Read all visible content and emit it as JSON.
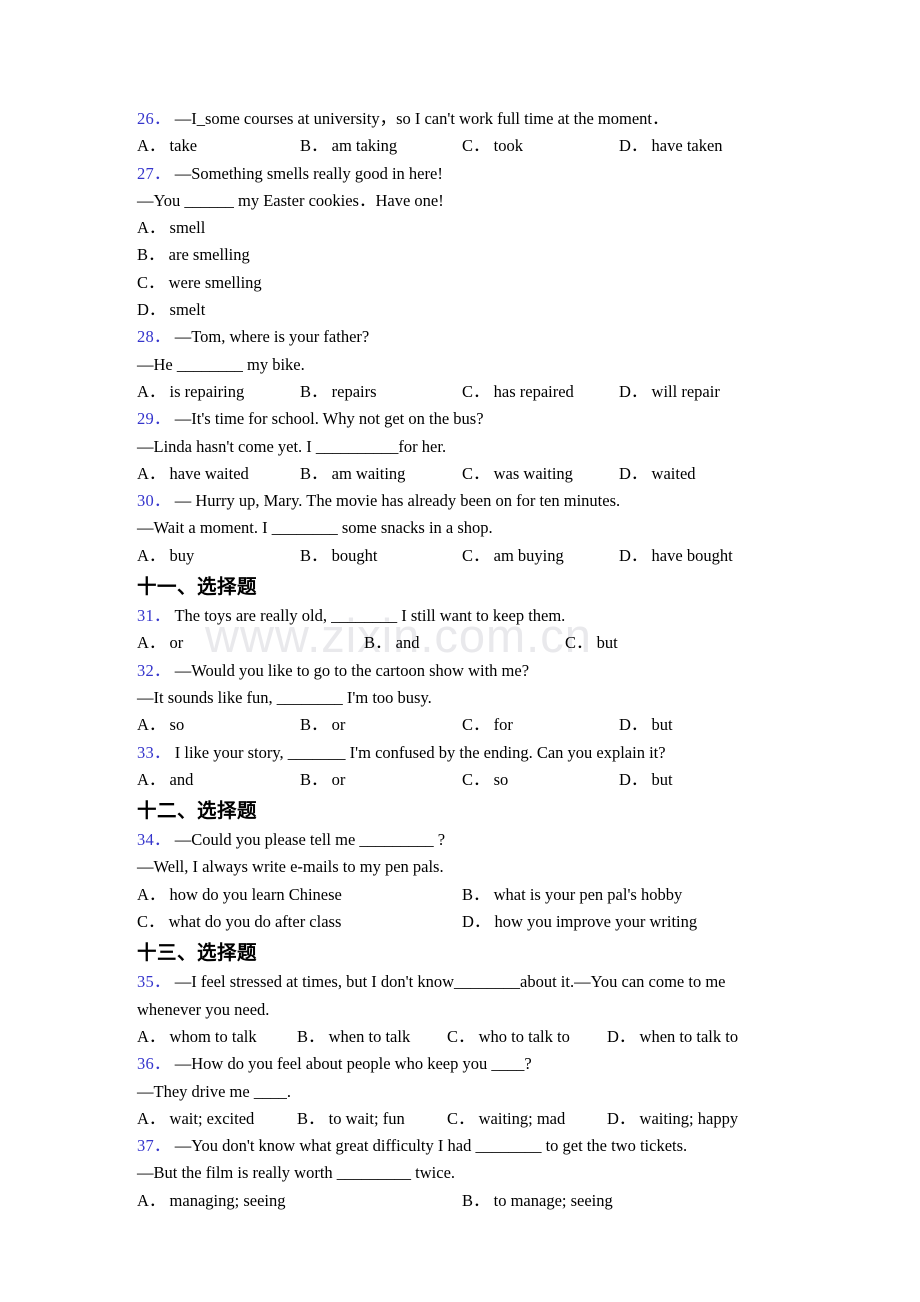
{
  "watermark": {
    "text": "www.zixin.com.cn",
    "color": "#e9e9ec"
  },
  "accent": {
    "question_number_color": "#3535cc"
  },
  "blocks": [
    {
      "kind": "question",
      "number": "26．",
      "stem": "—I_some courses at university，so I can't work full time at the moment．",
      "layout": "c4",
      "options": [
        {
          "letter": "A．",
          "text": "take"
        },
        {
          "letter": "B．",
          "text": "am taking"
        },
        {
          "letter": "C．",
          "text": "took"
        },
        {
          "letter": "D．",
          "text": "have taken"
        }
      ]
    },
    {
      "kind": "question",
      "number": "27．",
      "stem": "—Something smells really good in here!",
      "stem2": "—You ______ my Easter cookies．Have one!",
      "layout": "stacked",
      "options": [
        {
          "letter": "A．",
          "text": "smell"
        },
        {
          "letter": "B．",
          "text": "are smelling"
        },
        {
          "letter": "C．",
          "text": "were smelling"
        },
        {
          "letter": "D．",
          "text": "smelt"
        }
      ]
    },
    {
      "kind": "question",
      "number": "28．",
      "stem": "—Tom, where is your father?",
      "stem2": "—He ________ my bike.",
      "layout": "c4",
      "options": [
        {
          "letter": "A．",
          "text": "is repairing"
        },
        {
          "letter": "B．",
          "text": "repairs"
        },
        {
          "letter": "C．",
          "text": "has repaired"
        },
        {
          "letter": "D．",
          "text": "will repair"
        }
      ]
    },
    {
      "kind": "question",
      "number": "29．",
      "stem": "—It's time for school. Why not get on the bus?",
      "stem2": "—Linda hasn't come yet. I __________for her.",
      "layout": "c4",
      "options": [
        {
          "letter": "A．",
          "text": "have waited"
        },
        {
          "letter": "B．",
          "text": "am waiting"
        },
        {
          "letter": "C．",
          "text": "was waiting"
        },
        {
          "letter": "D．",
          "text": "waited"
        }
      ]
    },
    {
      "kind": "question",
      "number": "30．",
      "stem": "— Hurry up, Mary. The movie has already been on for ten minutes.",
      "stem2": "—Wait a moment. I ________ some snacks in a shop.",
      "layout": "c4",
      "options": [
        {
          "letter": "A．",
          "text": "buy"
        },
        {
          "letter": "B．",
          "text": "bought"
        },
        {
          "letter": "C．",
          "text": "am buying"
        },
        {
          "letter": "D．",
          "text": "have bought"
        }
      ]
    },
    {
      "kind": "heading",
      "text": "十一、选择题"
    },
    {
      "kind": "question",
      "number": "31．",
      "stem": "The toys are really old, ________ I still want to keep them.",
      "layout": "c3",
      "options": [
        {
          "letter": "A．",
          "text": "or"
        },
        {
          "letter": "B．",
          "text": "and"
        },
        {
          "letter": "C．",
          "text": "but"
        }
      ]
    },
    {
      "kind": "question",
      "number": "32．",
      "stem": "—Would you like to go to the cartoon show with me?",
      "stem2": "—It sounds like fun, ________ I'm too busy.",
      "layout": "c4",
      "options": [
        {
          "letter": "A．",
          "text": "so"
        },
        {
          "letter": "B．",
          "text": "or"
        },
        {
          "letter": "C．",
          "text": "for"
        },
        {
          "letter": "D．",
          "text": "but"
        }
      ]
    },
    {
      "kind": "question",
      "number": "33．",
      "stem": "I like your story, _______ I'm confused by the ending. Can you explain it?",
      "layout": "c4",
      "options": [
        {
          "letter": "A．",
          "text": "and"
        },
        {
          "letter": "B．",
          "text": "or"
        },
        {
          "letter": "C．",
          "text": "so"
        },
        {
          "letter": "D．",
          "text": "but"
        }
      ]
    },
    {
      "kind": "heading",
      "text": "十二、选择题"
    },
    {
      "kind": "question",
      "number": "34．",
      "stem": "—Could you please tell me _________ ?",
      "stem2": "—Well, I always write e-mails to my pen pals.",
      "layout": "c2x2",
      "options": [
        {
          "letter": "A．",
          "text": "how do you learn Chinese"
        },
        {
          "letter": "B．",
          "text": "what is your pen pal's hobby"
        },
        {
          "letter": "C．",
          "text": "what do you do after class"
        },
        {
          "letter": "D．",
          "text": "how you improve your writing"
        }
      ]
    },
    {
      "kind": "heading",
      "text": "十三、选择题"
    },
    {
      "kind": "question",
      "number": "35．",
      "stem": "—I feel stressed at times, but I don't know________about it.—You can come to me",
      "stem2": "whenever you need.",
      "stem2_plain": true,
      "layout": "c4n",
      "options": [
        {
          "letter": "A．",
          "text": "whom to talk"
        },
        {
          "letter": "B．",
          "text": "when to talk"
        },
        {
          "letter": "C．",
          "text": "who to talk to"
        },
        {
          "letter": "D．",
          "text": "when to talk to"
        }
      ]
    },
    {
      "kind": "question",
      "number": "36．",
      "stem": "—How do you feel about people who keep you ____?",
      "stem2": "—They drive me ____.",
      "layout": "c4n",
      "options": [
        {
          "letter": "A．",
          "text": "wait; excited"
        },
        {
          "letter": "B．",
          "text": "to wait; fun"
        },
        {
          "letter": "C．",
          "text": "waiting; mad"
        },
        {
          "letter": "D．",
          "text": "waiting; happy"
        }
      ]
    },
    {
      "kind": "question",
      "number": "37．",
      "stem": "—You don't know what great difficulty I had ________ to get the two tickets.",
      "stem2": "—But the film is really worth _________ twice.",
      "layout": "c2",
      "options": [
        {
          "letter": "A．",
          "text": "managing; seeing"
        },
        {
          "letter": "B．",
          "text": "to manage; seeing"
        }
      ]
    }
  ]
}
